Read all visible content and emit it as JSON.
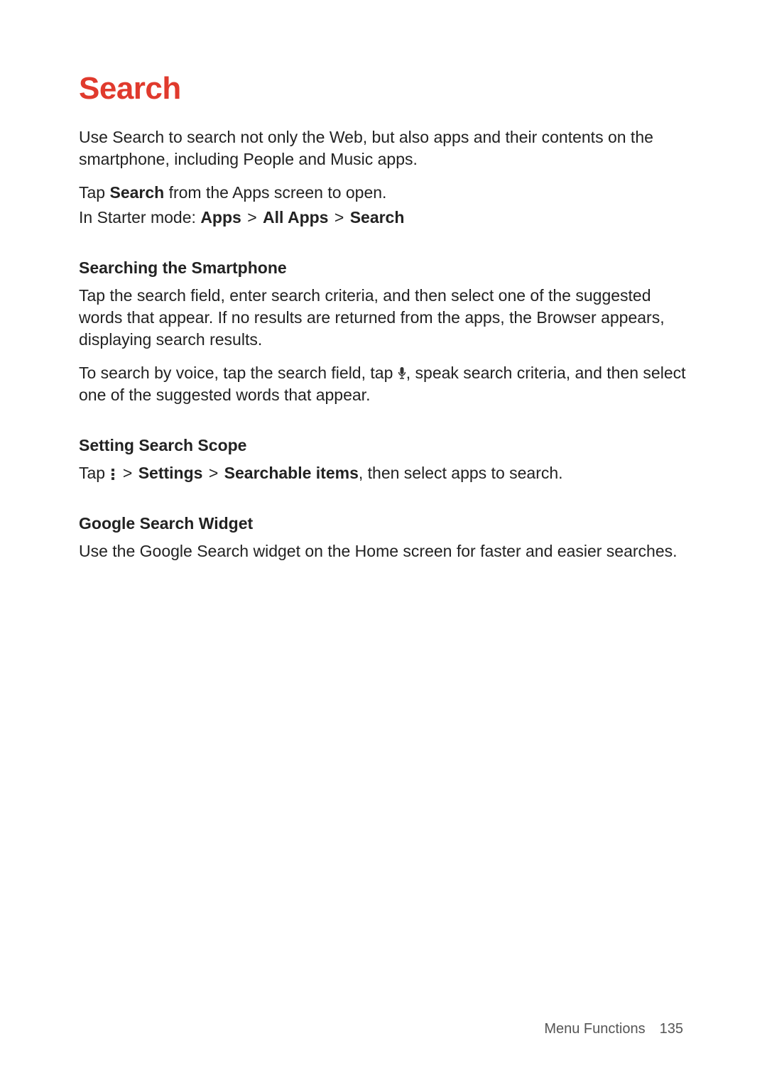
{
  "title": "Search",
  "intro": "Use Search to search not only the Web, but also apps and their contents on the smartphone, including People and Music apps.",
  "open_line": {
    "prefix": "Tap ",
    "bold": "Search",
    "suffix": " from the Apps screen to open."
  },
  "starter_line": {
    "prefix": "In Starter mode: ",
    "b1": "Apps",
    "b2": "All Apps",
    "b3": "Search",
    "gt": ">"
  },
  "s1": {
    "head": "Searching the Smartphone",
    "p1": "Tap the search field, enter search criteria, and then select one of the suggested words that appear. If no results are returned from the apps, the Browser appears, displaying search results.",
    "p2a": "To search by voice, tap the search field, tap ",
    "p2b": ", speak search criteria, and then select one of the suggested words that appear."
  },
  "s2": {
    "head": "Setting Search Scope",
    "tap": "Tap ",
    "gt": ">",
    "b1": "Settings",
    "b2": "Searchable items",
    "suffix": ", then select apps to search."
  },
  "s3": {
    "head": "Google Search Widget",
    "p": "Use the Google Search widget on the Home screen for faster and easier searches."
  },
  "footer": {
    "section": "Menu Functions",
    "page": "135"
  }
}
